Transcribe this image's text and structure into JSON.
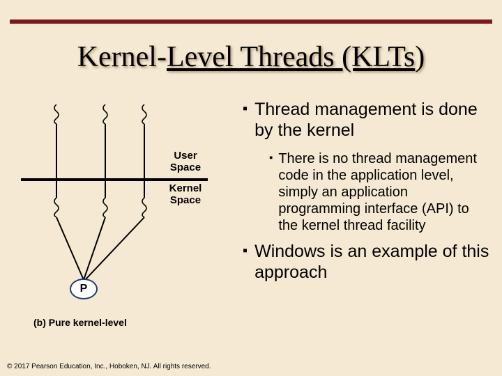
{
  "title_a": "Kernel-",
  "title_b": "Level Threads (KLTs",
  "title_c": ")",
  "bullet1": "Thread management is done by the kernel",
  "bullet2": "There is no thread management code in the application level, simply an application programming interface (API) to the kernel thread facility",
  "bullet3": "Windows is an example of this approach",
  "labels": {
    "user_l1": "User",
    "user_l2": "Space",
    "kernel_l1": "Kernel",
    "kernel_l2": "Space",
    "p": "P",
    "caption": "(b) Pure kernel-level"
  },
  "footer": "© 2017 Pearson Education, Inc., Hoboken, NJ. All rights reserved."
}
